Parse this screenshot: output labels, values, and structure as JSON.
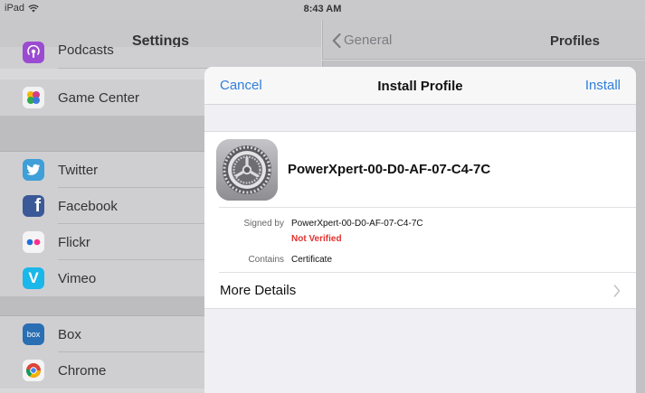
{
  "status_bar": {
    "device": "iPad",
    "time": "8:43 AM"
  },
  "master": {
    "title": "Settings",
    "rows": [
      {
        "label": "Podcasts",
        "icon": "podcasts-icon",
        "color": "#9b4bd1"
      },
      {
        "label": "Game Center",
        "icon": "game-center-icon",
        "color": "#ffffff"
      },
      {
        "label": "Twitter",
        "icon": "twitter-icon",
        "color": "#3f9fd8"
      },
      {
        "label": "Facebook",
        "icon": "facebook-icon",
        "color": "#3b5998"
      },
      {
        "label": "Flickr",
        "icon": "flickr-icon",
        "color": "#ffffff"
      },
      {
        "label": "Vimeo",
        "icon": "vimeo-icon",
        "color": "#1ab7ea"
      },
      {
        "label": "Box",
        "icon": "box-icon",
        "color": "#2a6fb3"
      },
      {
        "label": "Chrome",
        "icon": "chrome-icon",
        "color": "#ffffff"
      }
    ]
  },
  "detail": {
    "back_label": "General",
    "title": "Profiles"
  },
  "modal": {
    "cancel_label": "Cancel",
    "title": "Install Profile",
    "install_label": "Install",
    "profile_name": "PowerXpert-00-D0-AF-07-C4-7C",
    "signed_by_label": "Signed by",
    "signed_by_value": "PowerXpert-00-D0-AF-07-C4-7C",
    "verification_status": "Not Verified",
    "contains_label": "Contains",
    "contains_value": "Certificate",
    "more_details_label": "More Details"
  },
  "colors": {
    "accent": "#2f7ed8",
    "warning": "#e0332f"
  }
}
